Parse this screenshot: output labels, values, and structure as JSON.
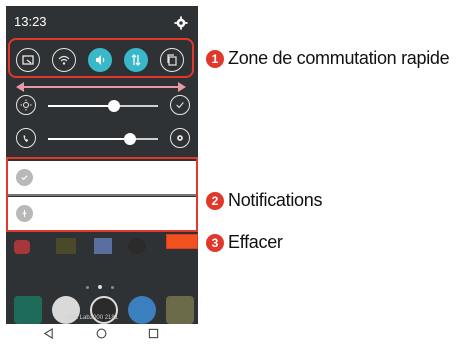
{
  "status_bar": {
    "time": "13:23",
    "settings_icon": "gear-icon"
  },
  "quick_settings": [
    {
      "name": "screen-capture-icon",
      "active": false
    },
    {
      "name": "wifi-icon",
      "active": false
    },
    {
      "name": "sound-icon",
      "active": true
    },
    {
      "name": "data-icon",
      "active": true
    },
    {
      "name": "copy-icon",
      "active": false
    }
  ],
  "sliders": [
    {
      "name": "brightness",
      "level": 0.6,
      "left_icon": "brightness-icon",
      "right_icon": "auto-check-icon"
    },
    {
      "name": "volume",
      "level": 0.75,
      "left_icon": "phone-volume-icon",
      "right_icon": "settings-icon"
    }
  ],
  "notifications": [
    {
      "icon": "check-icon"
    },
    {
      "icon": "usb-icon"
    }
  ],
  "home": {
    "carrier_text": "LGE Lab2000 2181"
  },
  "callouts": [
    {
      "number": "1",
      "label": "Zone de commutation rapide"
    },
    {
      "number": "2",
      "label": "Notifications"
    },
    {
      "number": "3",
      "label": "Effacer"
    }
  ],
  "colors": {
    "accent": "#39b8c9",
    "callout": "#e0392b",
    "clear": "#f0521e"
  }
}
